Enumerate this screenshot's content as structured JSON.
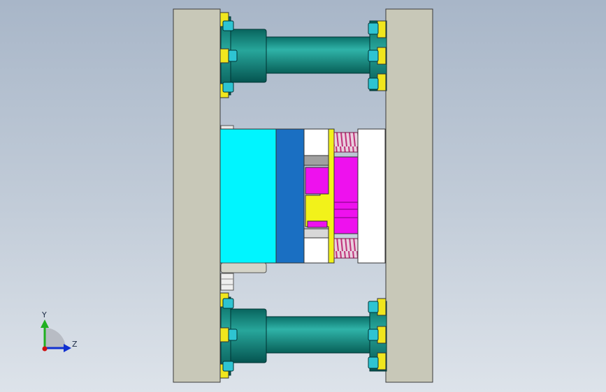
{
  "viewport": {
    "background_top": "#a8b6c8",
    "background_bottom": "#dde3ea"
  },
  "colors": {
    "clamp_plate": "#c8c8b8",
    "tie_bar": "#0f8f86",
    "tie_bar_highlight": "#38b8ae",
    "bolt_head": "#2ec4d2",
    "washer": "#f0e61e",
    "cavity_plate": "#00f5ff",
    "core_plate": "#1a6fc2",
    "ejector": "#ee11ee",
    "ejector_plate": "#f2f21a",
    "spring": "#c84a8c",
    "spacer": "#ffffff"
  },
  "triad": {
    "y_label": "Y",
    "z_label": "Z",
    "x_axis_color": "#d01010",
    "y_axis_color": "#20b020",
    "z_axis_color": "#1030d0"
  }
}
